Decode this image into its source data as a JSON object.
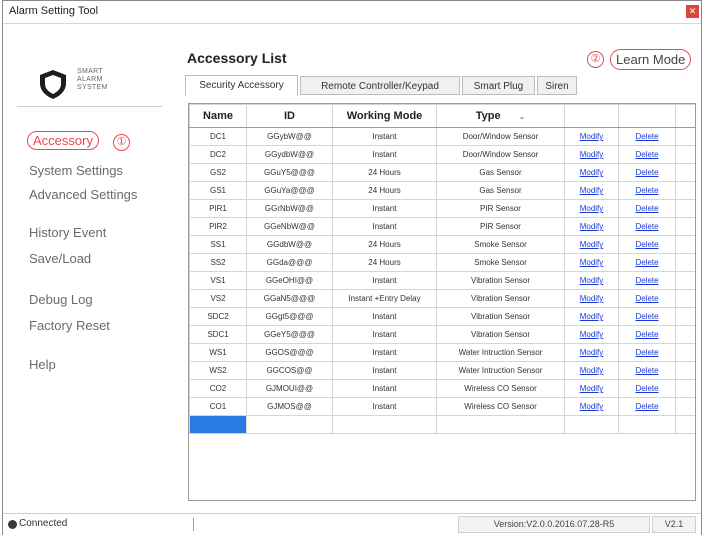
{
  "window": {
    "title": "Alarm Setting Tool"
  },
  "logo": {
    "lines": [
      "SMART",
      "ALARM",
      "SYSTEM"
    ]
  },
  "sidebar": {
    "items": [
      {
        "label": "Accessory",
        "badge": "①"
      },
      {
        "label": "System Settings"
      },
      {
        "label": "Advanced Settings"
      },
      {
        "label": "History Event"
      },
      {
        "label": "Save/Load"
      },
      {
        "label": "Debug Log"
      },
      {
        "label": "Factory Reset"
      },
      {
        "label": "Help"
      }
    ]
  },
  "main": {
    "title": "Accessory List",
    "learn_mode": {
      "badge": "②",
      "label": "Learn Mode"
    },
    "tabs": [
      {
        "label": "Security Accessory",
        "active": true
      },
      {
        "label": "Remote Controller/Keypad"
      },
      {
        "label": "Smart Plug"
      },
      {
        "label": "Siren"
      }
    ]
  },
  "table": {
    "columns": [
      "Name",
      "ID",
      "Working Mode",
      "Type"
    ],
    "rows": [
      {
        "name": "DC1",
        "id": "GGybW@@",
        "mode": "Instant",
        "type": "Door/Window Sensor",
        "modify": "Modify",
        "delete": "Delete"
      },
      {
        "name": "DC2",
        "id": "GGydbW@@",
        "mode": "Instant",
        "type": "Door/Window Sensor",
        "modify": "Modify",
        "delete": "Delete"
      },
      {
        "name": "GS2",
        "id": "GGuY5@@@",
        "mode": "24 Hours",
        "type": "Gas Sensor",
        "modify": "Modify",
        "delete": "Delete"
      },
      {
        "name": "GS1",
        "id": "GGuYa@@@",
        "mode": "24 Hours",
        "type": "Gas Sensor",
        "modify": "Modify",
        "delete": "Delete"
      },
      {
        "name": "PIR1",
        "id": "GGrNbW@@",
        "mode": "Instant",
        "type": "PIR Sensor",
        "modify": "Modify",
        "delete": "Delete"
      },
      {
        "name": "PIR2",
        "id": "GGeNbW@@",
        "mode": "Instant",
        "type": "PIR Sensor",
        "modify": "Modify",
        "delete": "Delete"
      },
      {
        "name": "SS1",
        "id": "GGdbW@@",
        "mode": "24 Hours",
        "type": "Smoke Sensor",
        "modify": "Modify",
        "delete": "Delete"
      },
      {
        "name": "SS2",
        "id": "GGda@@@",
        "mode": "24 Hours",
        "type": "Smoke Sensor",
        "modify": "Modify",
        "delete": "Delete"
      },
      {
        "name": "VS1",
        "id": "GGeOHI@@",
        "mode": "Instant",
        "type": "Vibration Sensor",
        "modify": "Modify",
        "delete": "Delete"
      },
      {
        "name": "VS2",
        "id": "GGaN5@@@",
        "mode": "Instant +Entry Delay",
        "type": "Vibration Sensor",
        "modify": "Modify",
        "delete": "Delete"
      },
      {
        "name": "SDC2",
        "id": "GGgt5@@@",
        "mode": "Instant",
        "type": "Vibration Sensor",
        "modify": "Modify",
        "delete": "Delete"
      },
      {
        "name": "SDC1",
        "id": "GGeY5@@@",
        "mode": "Instant",
        "type": "Vibration Sensor",
        "modify": "Modify",
        "delete": "Delete"
      },
      {
        "name": "WS1",
        "id": "GGOS@@@",
        "mode": "Instant",
        "type": "Water Intruction Sensor",
        "modify": "Modify",
        "delete": "Delete"
      },
      {
        "name": "WS2",
        "id": "GGCOS@@",
        "mode": "Instant",
        "type": "Water Intruction Sensor",
        "modify": "Modify",
        "delete": "Delete"
      },
      {
        "name": "CO2",
        "id": "GJMOUI@@",
        "mode": "Instant",
        "type": "Wireless CO Sensor",
        "modify": "Modify",
        "delete": "Delete"
      },
      {
        "name": "CO1",
        "id": "GJMOS@@",
        "mode": "Instant",
        "type": "Wireless CO Sensor",
        "modify": "Modify",
        "delete": "Delete"
      }
    ]
  },
  "status": {
    "connection": "Connected",
    "version": "Version:V2.0.0.2016.07.28-R5",
    "version_short": "V2.1"
  },
  "colors": {
    "accent": "#e8484f",
    "link": "#1a3ad6",
    "selected": "#2a7ae4"
  },
  "icons": {
    "close": "close-icon",
    "logo": "shield-icon",
    "sort": "sort-down-icon",
    "status": "status-dot-icon"
  }
}
